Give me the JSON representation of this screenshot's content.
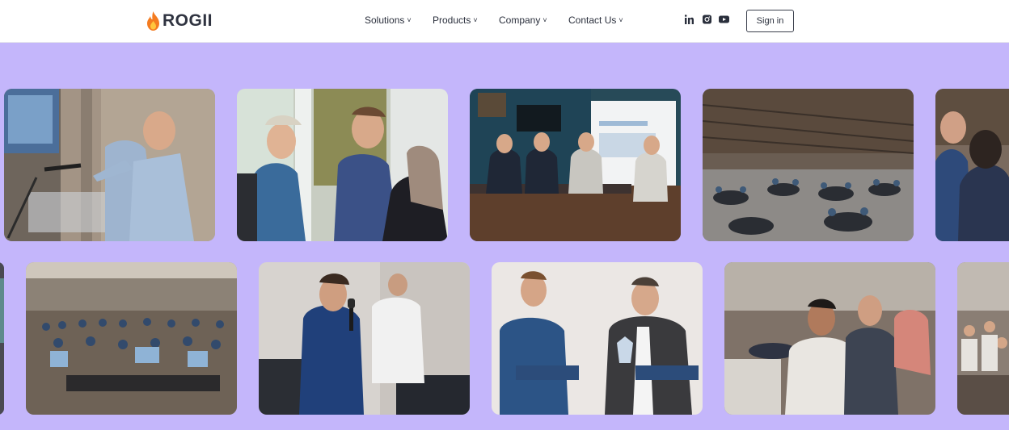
{
  "brand": {
    "name": "ROGII",
    "flame_color": "#f47b20"
  },
  "nav": [
    {
      "label": "Solutions",
      "chevron": "˅"
    },
    {
      "label": "Products",
      "chevron": "˅"
    },
    {
      "label": "Company",
      "chevron": "˅"
    },
    {
      "label": "Contact Us",
      "chevron": "˅"
    }
  ],
  "social": [
    "linkedin-icon",
    "instagram-icon",
    "youtube-icon"
  ],
  "signin_label": "Sign in",
  "colors": {
    "band": "#c4b6fb",
    "text": "#2a2f3c"
  },
  "gallery": {
    "row1": [
      "speaker-at-podium-photo",
      "networking-conversation-photo",
      "panel-discussion-photo",
      "conference-hall-photo",
      "attendees-partial-photo"
    ],
    "row2": [
      "partial-left-photo",
      "seated-audience-photo",
      "presenter-with-microphone-photo",
      "award-presentation-photo",
      "audience-discussion-photo",
      "crowd-partial-photo"
    ]
  }
}
